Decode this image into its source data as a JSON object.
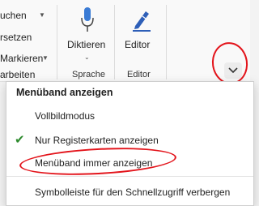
{
  "ribbon": {
    "items": [
      "uchen",
      "rsetzen",
      "Markieren",
      "arbeiten"
    ],
    "diktieren_label": "Diktieren",
    "editor_label": "Editor",
    "groups": [
      "Sprache",
      "Editor"
    ],
    "collapse_icon": "chevron-down-icon"
  },
  "menu": {
    "header": "Menüband anzeigen",
    "items": [
      {
        "label": "Vollbildmodus",
        "checked": false
      },
      {
        "label": "Nur Registerkarten anzeigen",
        "checked": true
      },
      {
        "label": "Menüband immer anzeigen",
        "checked": false
      },
      {
        "label": "Symbolleiste für den Schnellzugriff verbergen",
        "checked": false
      }
    ]
  },
  "colors": {
    "annotation": "#e3141b",
    "check": "#2e8b2e",
    "mic": "#3a7bd5"
  }
}
